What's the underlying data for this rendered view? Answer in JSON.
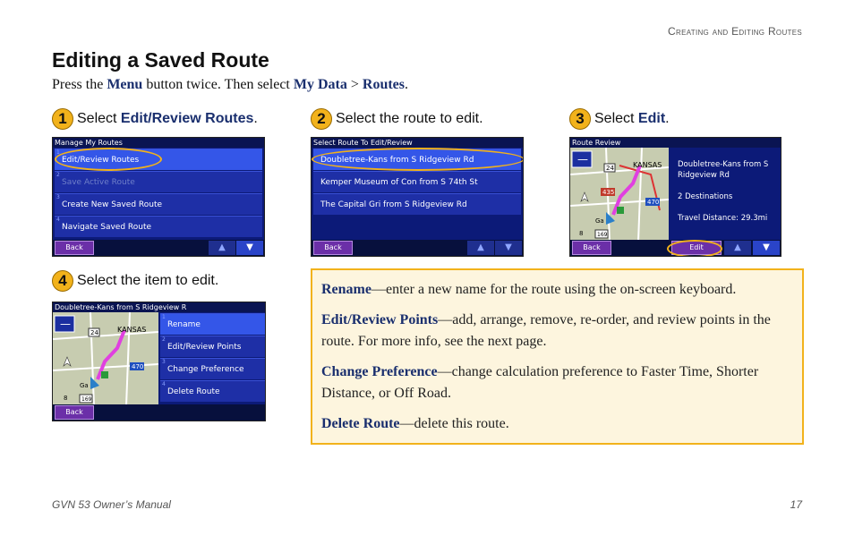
{
  "header": {
    "section": "Creating and Editing Routes"
  },
  "title": "Editing a Saved Route",
  "intro": {
    "pre": "Press the",
    "menu": "Menu",
    "mid": "button twice. Then select",
    "mydata": "My Data",
    "sep": ">",
    "routes": "Routes",
    "end": "."
  },
  "steps": [
    {
      "num": "1",
      "pre": "Select",
      "bold": "Edit/Review Routes",
      "post": "."
    },
    {
      "num": "2",
      "text": "Select the route to edit."
    },
    {
      "num": "3",
      "pre": "Select",
      "bold": "Edit",
      "post": "."
    },
    {
      "num": "4",
      "text": "Select the item to edit."
    }
  ],
  "screen1": {
    "title": "Manage My Routes",
    "items": [
      "Edit/Review Routes",
      "Save Active Route",
      "Create New Saved Route",
      "Navigate Saved Route"
    ],
    "back": "Back"
  },
  "screen2": {
    "title": "Select Route To Edit/Review",
    "items": [
      "Doubletree-Kans from S Ridgeview Rd",
      "Kemper Museum of Con from S 74th St",
      "The Capital Gri from S Ridgeview Rd"
    ],
    "back": "Back"
  },
  "screen3": {
    "title": "Route Review",
    "route_name": "Doubletree-Kans from S Ridgeview Rd",
    "destinations": "2 Destinations",
    "distance": "Travel Distance: 29.3mi",
    "back": "Back",
    "edit": "Edit",
    "map_labels": {
      "city": "KANSAS",
      "hwy1": "24",
      "hwy2": "435",
      "hwy3": "470",
      "hwy4": "169",
      "hwy5": "8",
      "town": "Ga"
    }
  },
  "screen4": {
    "title": "Doubletree-Kans from S Ridgeview R",
    "items": [
      "Rename",
      "Edit/Review Points",
      "Change Preference",
      "Delete Route"
    ],
    "back": "Back",
    "map_labels": {
      "city": "KANSAS",
      "hwy1": "24",
      "hwy3": "470",
      "hwy4": "169",
      "hwy5": "8",
      "town": "Ga"
    }
  },
  "info": {
    "rename_term": "Rename",
    "rename_desc": "—enter a new name for the route using the on-screen keyboard.",
    "edit_term": "Edit/Review Points",
    "edit_desc": "—add, arrange, remove, re-order, and review points in the route. For more info, see the next page.",
    "pref_term": "Change Preference",
    "pref_desc": "—change calculation preference to Faster Time, Shorter Distance, or Off Road.",
    "delete_term": "Delete Route",
    "delete_desc": "—delete this route."
  },
  "footer": {
    "manual": "GVN 53 Owner’s Manual",
    "page": "17"
  },
  "icons": {
    "up": "up-arrow-icon",
    "down": "down-arrow-icon",
    "zoom_out": "minus-icon",
    "compass": "compass-icon"
  },
  "colors": {
    "accent": "#f2b21b",
    "heading_blue": "#1a2f6e",
    "screen_bg": "#0c1a78"
  }
}
